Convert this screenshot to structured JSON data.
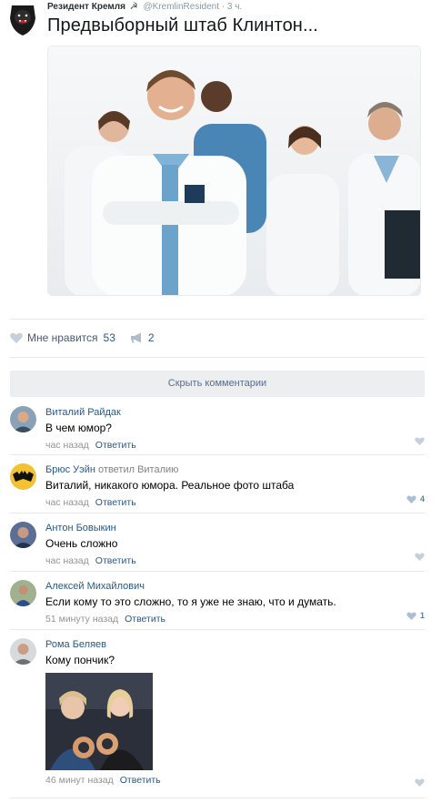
{
  "tweet": {
    "author_name": "Резидент Кремля",
    "handle_time": "@KremlinResident · 3 ч.",
    "text": "Предвыборный штаб Клинтон..."
  },
  "post_actions": {
    "like_label": "Мне нравится",
    "like_count": "53",
    "share_count": "2"
  },
  "hide_comments_label": "Скрыть комментарии",
  "comments": [
    {
      "author": "Виталий Райдак",
      "replied_to": "",
      "text": "В чем юмор?",
      "time": "час назад",
      "reply_label": "Ответить",
      "likes": ""
    },
    {
      "author": "Брюс Уэйн",
      "replied_to": "ответил Виталию",
      "text": "Виталий, никакого юмора. Реальное фото штаба",
      "time": "час назад",
      "reply_label": "Ответить",
      "likes": "4"
    },
    {
      "author": "Антон Бовыкин",
      "replied_to": "",
      "text": "Очень сложно",
      "time": "час назад",
      "reply_label": "Ответить",
      "likes": ""
    },
    {
      "author": "Алексей Михайлович",
      "replied_to": "",
      "text": "Если кому то это сложно, то я уже не знаю, что и думать.",
      "time": "51 минуту назад",
      "reply_label": "Ответить",
      "likes": "1"
    },
    {
      "author": "Рома Беляев",
      "replied_to": "",
      "text": "Кому пончик?",
      "time": "46 минут назад",
      "reply_label": "Ответить",
      "likes": ""
    }
  ],
  "colors": {
    "link": "#2a5885",
    "meta": "#939393",
    "button_bg": "#edeef0",
    "like_icon": "#c5d0db"
  }
}
